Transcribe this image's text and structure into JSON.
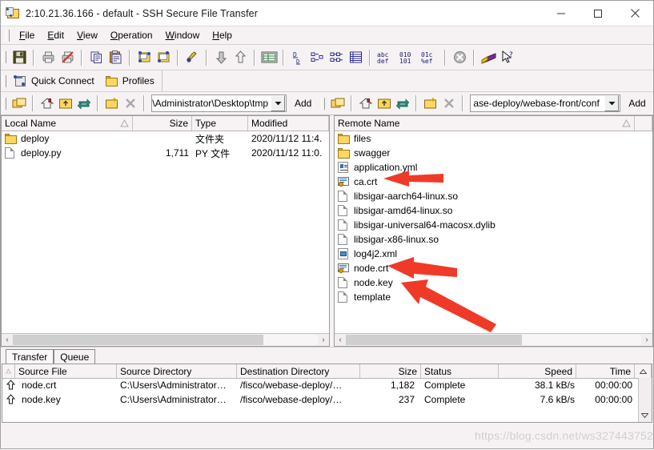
{
  "window": {
    "title": "2:10.21.36.166 - default - SSH Secure File Transfer",
    "icon": "app-folder-icon",
    "minimize": "—",
    "maximize": "☐",
    "close": "✕"
  },
  "menu": {
    "items": [
      {
        "label": "File",
        "accel": "F"
      },
      {
        "label": "Edit",
        "accel": "E"
      },
      {
        "label": "View",
        "accel": "V"
      },
      {
        "label": "Operation",
        "accel": "O"
      },
      {
        "label": "Window",
        "accel": "W"
      },
      {
        "label": "Help",
        "accel": "H"
      }
    ]
  },
  "toolbar": {
    "icons": [
      "save-icon",
      "print-icon",
      "print-cancel-icon",
      "copy-icon",
      "paste-icon",
      "new-file-transfer-window-icon",
      "new-terminal-window-icon",
      "settings-icon",
      "download-icon",
      "upload-icon",
      "list-view-icon",
      "large-icons-icon",
      "small-icons-icon",
      "list-icon",
      "details-icon",
      "ascii-transfer-icon",
      "binary-transfer-icon",
      "auto-transfer-icon",
      "disconnect-icon",
      "help-book-icon",
      "context-help-icon"
    ]
  },
  "connectbar": {
    "quick_connect": "Quick Connect",
    "profiles": "Profiles"
  },
  "local_pathbar": {
    "path_value": "s\\Administrator\\Desktop\\tmp\\",
    "add_label": "Add",
    "icons": [
      "go-up-one-level-icon",
      "home-icon",
      "root-folder-icon",
      "refresh-icon",
      "new-folder-icon",
      "delete-icon"
    ]
  },
  "remote_pathbar": {
    "path_value": "ase-deploy/webase-front/conf",
    "add_label": "Add",
    "icons": [
      "go-up-one-level-icon",
      "home-icon",
      "root-folder-icon",
      "refresh-icon",
      "new-folder-icon",
      "delete-icon"
    ]
  },
  "local_panel": {
    "columns": [
      {
        "key": "name",
        "label": "Local Name",
        "align": "left"
      },
      {
        "key": "size",
        "label": "Size",
        "align": "right"
      },
      {
        "key": "type",
        "label": "Type",
        "align": "left"
      },
      {
        "key": "modified",
        "label": "Modified",
        "align": "left"
      }
    ],
    "rows": [
      {
        "icon": "folder-icon",
        "name": "deploy",
        "size": "",
        "type": "文件夹",
        "modified": "2020/11/12 11:4."
      },
      {
        "icon": "file-icon",
        "name": "deploy.py",
        "size": "1,711",
        "type": "PY 文件",
        "modified": "2020/11/12 11:0."
      }
    ],
    "scroll": {
      "left_arrow": "‹",
      "right_arrow": "›"
    }
  },
  "remote_panel": {
    "columns": [
      {
        "key": "name",
        "label": "Remote Name",
        "align": "left"
      }
    ],
    "rows": [
      {
        "icon": "folder-icon",
        "name": "files"
      },
      {
        "icon": "folder-icon",
        "name": "swagger"
      },
      {
        "icon": "yml-file-icon",
        "name": "application.yml"
      },
      {
        "icon": "certificate-icon",
        "name": "ca.crt"
      },
      {
        "icon": "file-icon",
        "name": "libsigar-aarch64-linux.so"
      },
      {
        "icon": "file-icon",
        "name": "libsigar-amd64-linux.so"
      },
      {
        "icon": "file-icon",
        "name": "libsigar-universal64-macosx.dylib"
      },
      {
        "icon": "file-icon",
        "name": "libsigar-x86-linux.so"
      },
      {
        "icon": "xml-file-icon",
        "name": "log4j2.xml"
      },
      {
        "icon": "certificate-icon",
        "name": "node.crt"
      },
      {
        "icon": "file-icon",
        "name": "node.key"
      },
      {
        "icon": "file-icon",
        "name": "template"
      }
    ],
    "scroll": {
      "left_arrow": "‹",
      "right_arrow": "›"
    }
  },
  "bottom": {
    "tabs": [
      {
        "label": "Transfer",
        "active": true
      },
      {
        "label": "Queue",
        "active": false
      }
    ],
    "columns": [
      {
        "key": "sort",
        "label": "",
        "align": "left"
      },
      {
        "key": "source_file",
        "label": "Source File",
        "align": "left"
      },
      {
        "key": "source_dir",
        "label": "Source Directory",
        "align": "left"
      },
      {
        "key": "dest_dir",
        "label": "Destination Directory",
        "align": "left"
      },
      {
        "key": "size",
        "label": "Size",
        "align": "right"
      },
      {
        "key": "status",
        "label": "Status",
        "align": "left"
      },
      {
        "key": "speed",
        "label": "Speed",
        "align": "right"
      },
      {
        "key": "time",
        "label": "Time",
        "align": "right"
      }
    ],
    "rows": [
      {
        "direction": "upload-arrow-icon",
        "source_file": "node.crt",
        "source_dir": "C:\\Users\\Administrator…",
        "dest_dir": "/fisco/webase-deploy/…",
        "size": "1,182",
        "status": "Complete",
        "speed": "38.1 kB/s",
        "time": "00:00:00"
      },
      {
        "direction": "upload-arrow-icon",
        "source_file": "node.key",
        "source_dir": "C:\\Users\\Administrator…",
        "dest_dir": "/fisco/webase-deploy/…",
        "size": "237",
        "status": "Complete",
        "speed": "7.6 kB/s",
        "time": "00:00:00"
      }
    ]
  },
  "annotations": {
    "arrows": [
      "arrow-pointing-to-ca-crt",
      "arrow-pointing-to-node-crt",
      "arrow-pointing-to-node-key"
    ],
    "arrow_color": "#f03a28"
  },
  "watermark": {
    "text": "https://blog.csdn.net/ws327443752"
  }
}
